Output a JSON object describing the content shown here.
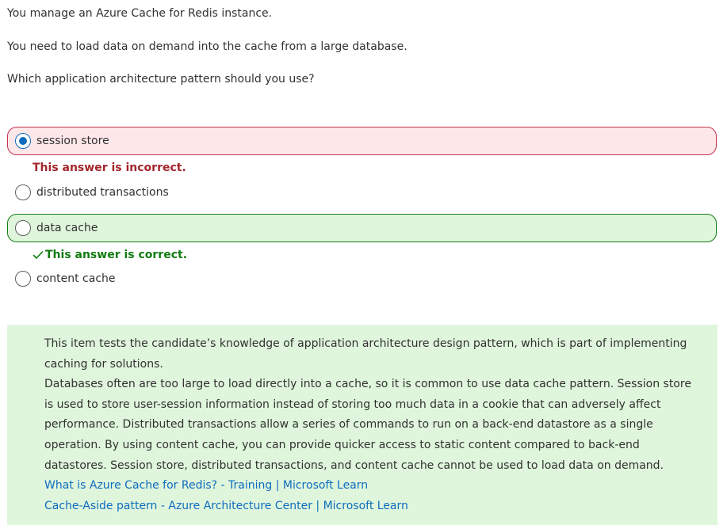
{
  "question": {
    "lines": [
      "You manage an Azure Cache for Redis instance.",
      "You need to load data on demand into the cache from a large database.",
      "Which application architecture pattern should you use?"
    ]
  },
  "options": [
    {
      "label": "session store",
      "selected": true,
      "state": "incorrect"
    },
    {
      "label": "distributed transactions",
      "selected": false,
      "state": "none"
    },
    {
      "label": "data cache",
      "selected": false,
      "state": "correct"
    },
    {
      "label": "content cache",
      "selected": false,
      "state": "none"
    }
  ],
  "feedback": {
    "incorrect": "This answer is incorrect.",
    "correct": "This answer is correct."
  },
  "explanation": {
    "lines": [
      "This item tests the candidate’s knowledge of application architecture design pattern, which is part of implementing",
      "caching for solutions.",
      "Databases often are too large to load directly into a cache, so it is common to use data cache pattern. Session store",
      "is used to store user-session information instead of storing too much data in a cookie that can adversely affect",
      "performance. Distributed transactions allow a series of commands to run on a back-end datastore as a single",
      "operation. By using content cache, you can provide quicker access to static content compared to back-end",
      "datastores. Session store, distributed transactions, and content cache cannot be used to load data on demand."
    ],
    "links": [
      "What is Azure Cache for Redis? - Training | Microsoft Learn",
      "Cache-Aside pattern - Azure Architecture Center | Microsoft Learn"
    ]
  },
  "colors": {
    "incorrect_bg": "#fde7e9",
    "incorrect_border": "#c4314b",
    "correct_bg": "#dff6dd",
    "correct_border": "#107c10",
    "link": "#0f6cbd",
    "radio_selected": "#0f6cbd"
  },
  "icons": {
    "correct_feedback": "checkmark-icon"
  }
}
